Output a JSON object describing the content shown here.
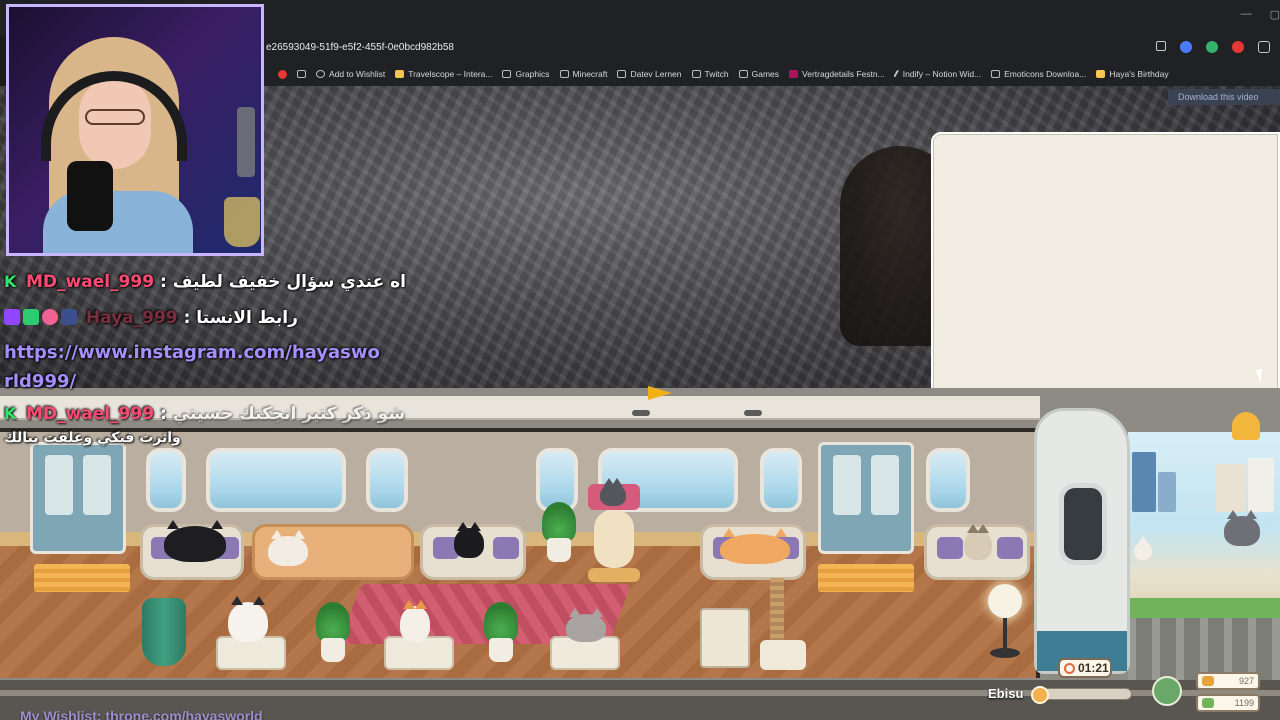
{
  "browser": {
    "url": "e26593049-51f9-e5f2-455f-0e0bcd982b58",
    "bookmarks": [
      {
        "label": "Add to Wishlist"
      },
      {
        "label": "Travelscope – Intera..."
      },
      {
        "label": "Graphics"
      },
      {
        "label": "Minecraft"
      },
      {
        "label": "Datev Lernen"
      },
      {
        "label": "Twitch"
      },
      {
        "label": "Games"
      },
      {
        "label": "Vertragdetails Festn..."
      },
      {
        "label": "Indify – Notion Wid..."
      },
      {
        "label": "Emoticons Downloa..."
      },
      {
        "label": "Haya's Birthday"
      }
    ],
    "download_button": "Download this video"
  },
  "chat": {
    "line1_user": "MD_wael_999",
    "line1_sep": ":",
    "line1_msg": "اه عندي سؤال خفيف لطيف",
    "line2_user": "Haya_999",
    "line2_sep": ":",
    "line2_msg": "رابط الانستا",
    "line2_link": "https://www.instagram.com/hayasworld999/",
    "line3_user": "MD_wael_999",
    "line3_sep": ":",
    "line3_msg": "شو ذكر كتير انجكتك حسيتي",
    "line3_msg2": "واثرت فيكي وعلقت ببالك"
  },
  "game": {
    "timer": "01:21",
    "station": "Ebisu",
    "progress": 0.08,
    "currency1": "927",
    "currency2": "1199"
  },
  "footer": {
    "wishlist": "My Wishlist: throne.com/hayasworld"
  },
  "colors": {
    "username": "#ff4a73",
    "link": "#a590ff",
    "badge_green": "#2ee86a"
  }
}
